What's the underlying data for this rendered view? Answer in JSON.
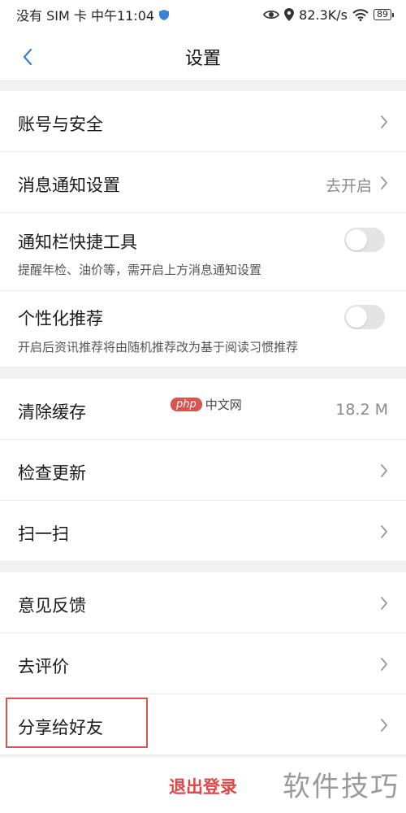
{
  "status_bar": {
    "left_text": "没有 SIM 卡 中午11:04",
    "speed": "82.3K/s",
    "battery": "89",
    "icons": [
      "shield-icon",
      "eye-icon",
      "location-icon",
      "wifi-icon",
      "battery-icon"
    ]
  },
  "header": {
    "title": "设置",
    "back_icon": "chevron-left-icon"
  },
  "settings": {
    "account": {
      "label": "账号与安全"
    },
    "notification": {
      "label": "消息通知设置",
      "value": "去开启"
    },
    "notify_tool": {
      "label": "通知栏快捷工具",
      "sub": "提醒年检、油价等，需开启上方消息通知设置",
      "enabled": false
    },
    "personalized": {
      "label": "个性化推荐",
      "sub": "开启后资讯推荐将由随机推荐改为基于阅读习惯推荐",
      "enabled": false
    },
    "cache": {
      "label": "清除缓存",
      "value": "18.2 M"
    },
    "update": {
      "label": "检查更新"
    },
    "scan": {
      "label": "扫一扫"
    },
    "feedback": {
      "label": "意见反馈"
    },
    "rate": {
      "label": "去评价"
    },
    "share": {
      "label": "分享给好友"
    }
  },
  "logout": {
    "label": "退出登录"
  },
  "watermarks": {
    "php_badge": "php",
    "php_text": "中文网",
    "corner": "软件技巧"
  },
  "colors": {
    "accent": "#3b7ddd",
    "logout": "#e04646",
    "highlight": "#d9534f"
  }
}
